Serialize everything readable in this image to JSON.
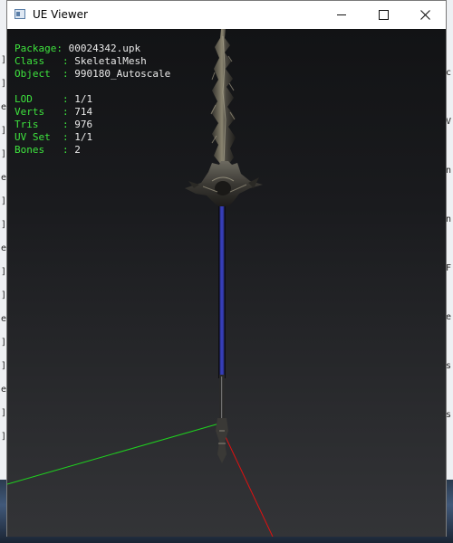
{
  "window": {
    "title": "UE Viewer",
    "controls": {
      "minimize": "minimize",
      "maximize": "maximize",
      "close": "close"
    }
  },
  "info_panel": {
    "mesh": [
      {
        "label": "Package: ",
        "value": "00024342.upk"
      },
      {
        "label": "Class   : ",
        "value": "SkeletalMesh"
      },
      {
        "label": "Object  : ",
        "value": "990180_Autoscale"
      }
    ],
    "stats": [
      {
        "label": "LOD     : ",
        "value": "1/1"
      },
      {
        "label": "Verts   : ",
        "value": "714"
      },
      {
        "label": "Tris    : ",
        "value": "976"
      },
      {
        "label": "UV Set  : ",
        "value": "1/1"
      },
      {
        "label": "Bones   : ",
        "value": "2"
      }
    ]
  },
  "viewport": {
    "axis_colors": {
      "x": "#e01010",
      "y": "#1fd21f"
    },
    "background": "#1b1c1f",
    "mesh_name": "sword"
  },
  "colors": {
    "info_label": "#3ee43e",
    "info_value": "#e9e9e9",
    "blade_blue": "#2a2f9c"
  },
  "background_console": {
    "left_glyphs": [
      "]",
      "]",
      "e",
      "]",
      "]",
      "e",
      "]",
      "]",
      "e",
      "]",
      "]",
      "e",
      "]",
      "]",
      "e",
      "]",
      "]"
    ],
    "right_glyphs": [
      "c",
      "V",
      "n",
      "n",
      "F",
      "e",
      "s",
      "s"
    ]
  }
}
